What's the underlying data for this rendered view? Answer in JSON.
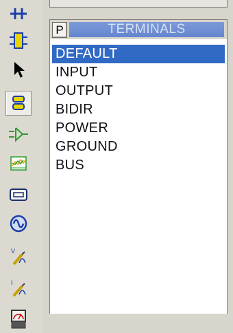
{
  "toolbar": {
    "tools": [
      {
        "icon": "junction-dot-icon"
      },
      {
        "icon": "component-icon"
      },
      {
        "icon": "selection-arrow-icon"
      },
      {
        "icon": "terminals-mode-icon",
        "active": true
      },
      {
        "icon": "device-pins-icon"
      },
      {
        "icon": "graph-icon"
      },
      {
        "icon": "tape-recorder-icon"
      },
      {
        "icon": "generator-icon"
      },
      {
        "icon": "voltage-probe-icon"
      },
      {
        "icon": "current-probe-icon"
      },
      {
        "icon": "virtual-instruments-icon"
      }
    ]
  },
  "panel": {
    "pick_button": "P",
    "title": "TERMINALS",
    "items": [
      "DEFAULT",
      "INPUT",
      "OUTPUT",
      "BIDIR",
      "POWER",
      "GROUND",
      "BUS"
    ],
    "selected": "DEFAULT"
  },
  "colors": {
    "selection": "#316ac5",
    "title_bar": "#6f8fd3",
    "icon_green": "#2e9b2e",
    "icon_yellow": "#e8d400",
    "icon_blue": "#1b3fa8"
  }
}
